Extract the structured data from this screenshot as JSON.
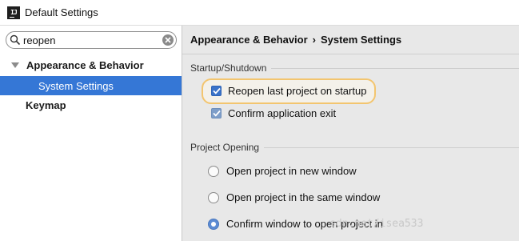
{
  "window": {
    "title": "Default Settings",
    "icon": "intellij-idea-icon"
  },
  "search": {
    "value": "reopen",
    "icon": "search-icon",
    "clear_icon": "clear-icon"
  },
  "tree": {
    "items": [
      {
        "label": "Appearance & Behavior",
        "expanded": true,
        "bold": true
      },
      {
        "label": "System Settings",
        "selected": true
      },
      {
        "label": "Keymap",
        "bold": true
      }
    ]
  },
  "breadcrumb": {
    "parts": [
      "Appearance & Behavior",
      "System Settings"
    ],
    "separator": "›"
  },
  "startup": {
    "title": "Startup/Shutdown",
    "reopen": {
      "label": "Reopen last project on startup",
      "checked": true
    },
    "confirm_exit": {
      "label": "Confirm application exit",
      "checked": true
    }
  },
  "project_opening": {
    "title": "Project Opening",
    "options": [
      {
        "label": "Open project in new window",
        "selected": false
      },
      {
        "label": "Open project in the same window",
        "selected": false
      },
      {
        "label": "Confirm window to open project in",
        "selected": true
      }
    ]
  },
  "watermark": "sdn.net/isea533",
  "colors": {
    "selection": "#3577d6",
    "accent_highlight": "#f3c56f",
    "checkbox": "#3b73c9"
  }
}
